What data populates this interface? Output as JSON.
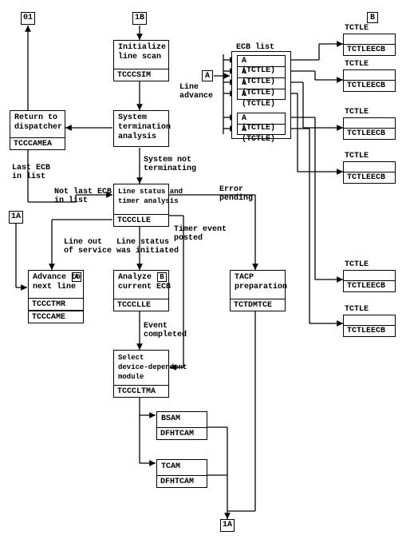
{
  "connectors": {
    "top01": "01",
    "top1B": "1B",
    "left1A": "1A",
    "bottom1A": "1A",
    "refA": "A",
    "refB": "B"
  },
  "boxes": {
    "init_scan": {
      "title": "Initialize\nline scan",
      "code": "TCCCSIM"
    },
    "return_disp": {
      "title": "Return to\ndispatcher",
      "code": "TCCCAMEA"
    },
    "sys_term": {
      "title": "System\ntermination\nanalysis"
    },
    "line_status": {
      "title": "Line status and\ntimer analysis",
      "code": "TCCCLLE"
    },
    "adv_next": {
      "title": "Advance to\nnext line",
      "code1": "TCCCTMR",
      "code2": "TCCCAME"
    },
    "analyze_ecb": {
      "title": "Analyze\ncurrent ECB",
      "code": "TCCCLLE"
    },
    "select_dev": {
      "title": "Select\ndevice-dependent\nmodule",
      "code": "TCCCLTMA"
    },
    "bsam": {
      "title": "BSAM",
      "code": "DFHTCAM"
    },
    "tcam": {
      "title": "TCAM",
      "code": "DFHTCAM"
    },
    "tacp": {
      "title": "TACP\npreparation",
      "code": "TCTDMTCE"
    }
  },
  "labels": {
    "ecb_list": "ECB list",
    "line_advance": "Line\nadvance",
    "tctle": "TCTLE",
    "tctleecb": "TCTLEECB",
    "sys_not_term": "System not\nterminating",
    "last_ecb": "Last ECB\nin list",
    "not_last_ecb": "Not last ECB\nin list",
    "error_pending": "Error\npending",
    "timer_event": "Timer event\nposted",
    "line_out": "Line out\nof service",
    "line_was_init": "Line status\nwas initiated",
    "event_completed": "Event\ncompleted",
    "a_tctle": "A (TCTLE)"
  }
}
